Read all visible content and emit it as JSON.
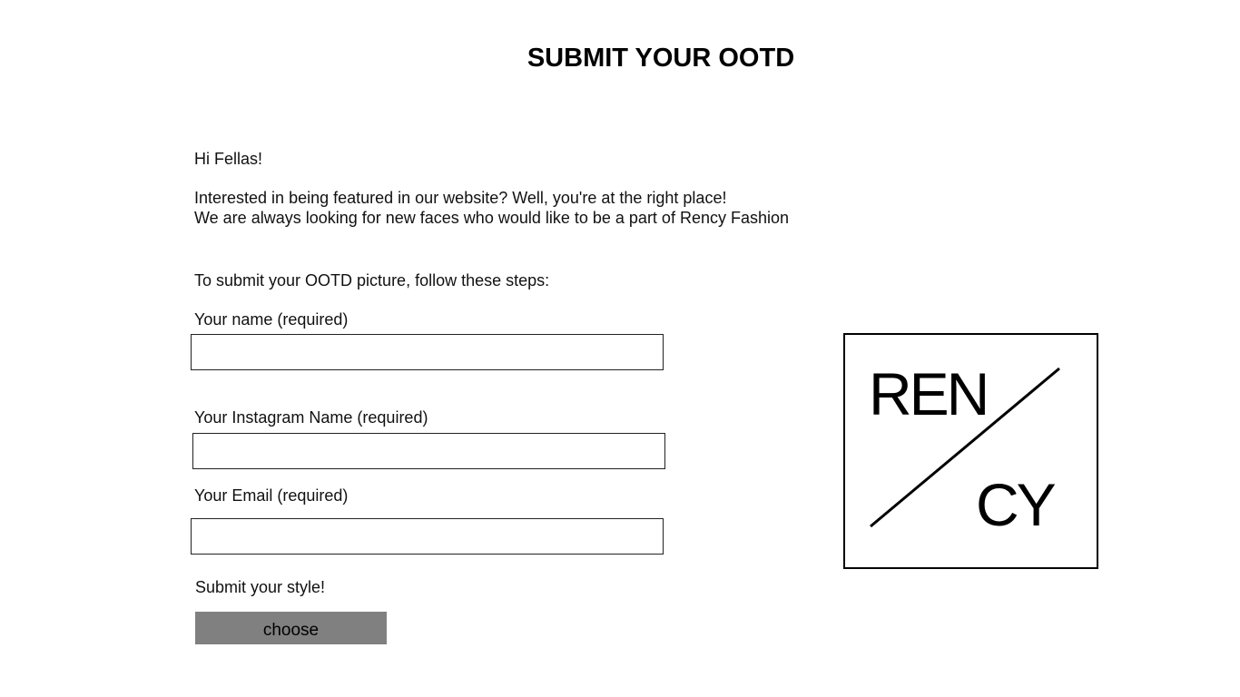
{
  "header": {
    "title": "SUBMIT YOUR OOTD"
  },
  "intro": {
    "greeting": "Hi Fellas!",
    "line1": "Interested in being featured in our website? Well, you're at the right place!",
    "line2": "We are always looking for new faces who would like to be a part of Rency Fashion"
  },
  "form": {
    "instructions": "To submit your OOTD picture, follow these steps:",
    "name_label": "Your name (required)",
    "name_value": "",
    "instagram_label": "Your Instagram Name (required)",
    "instagram_value": "",
    "email_label": "Your Email (required)",
    "email_value": "",
    "upload_label": "Submit your style!",
    "choose_button": "choose"
  },
  "logo": {
    "top_text": "REN",
    "bottom_text": "CY"
  }
}
